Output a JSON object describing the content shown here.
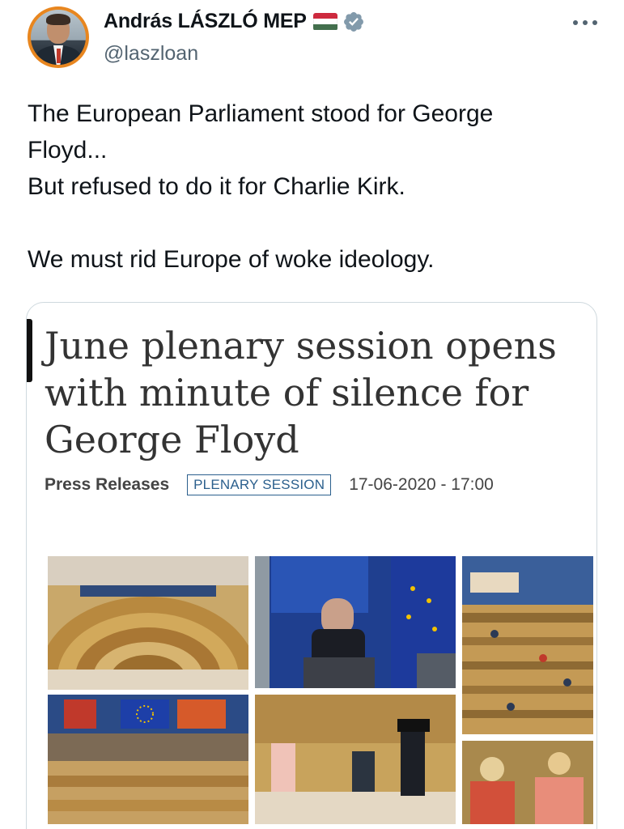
{
  "author": {
    "display_name": "András LÁSZLÓ MEP",
    "handle": "@laszloan",
    "flag_icon": "hungary-flag-icon",
    "verified_icon": "verified-badge-icon",
    "flag_colors": [
      "#cd2a3e",
      "#ffffff",
      "#436f4d"
    ],
    "verified_color": "#829aab",
    "avatar_ring_color": "#e8861f"
  },
  "tweet": {
    "lines": [
      "The European Parliament stood for George",
      "Floyd...",
      "But refused to do it for Charlie Kirk.",
      "",
      "We must rid Europe of woke ideology."
    ]
  },
  "card": {
    "title_lines": [
      "June plenary session opens",
      "with minute of silence for",
      "George Floyd"
    ],
    "category": "Press Releases",
    "tag": "PLENARY SESSION",
    "date": "17-06-2020 - 17:00",
    "accent_color": "#2b5f8d"
  },
  "colors": {
    "text_primary": "#0f1419",
    "text_secondary": "#536471",
    "card_border": "#cfd9de"
  }
}
